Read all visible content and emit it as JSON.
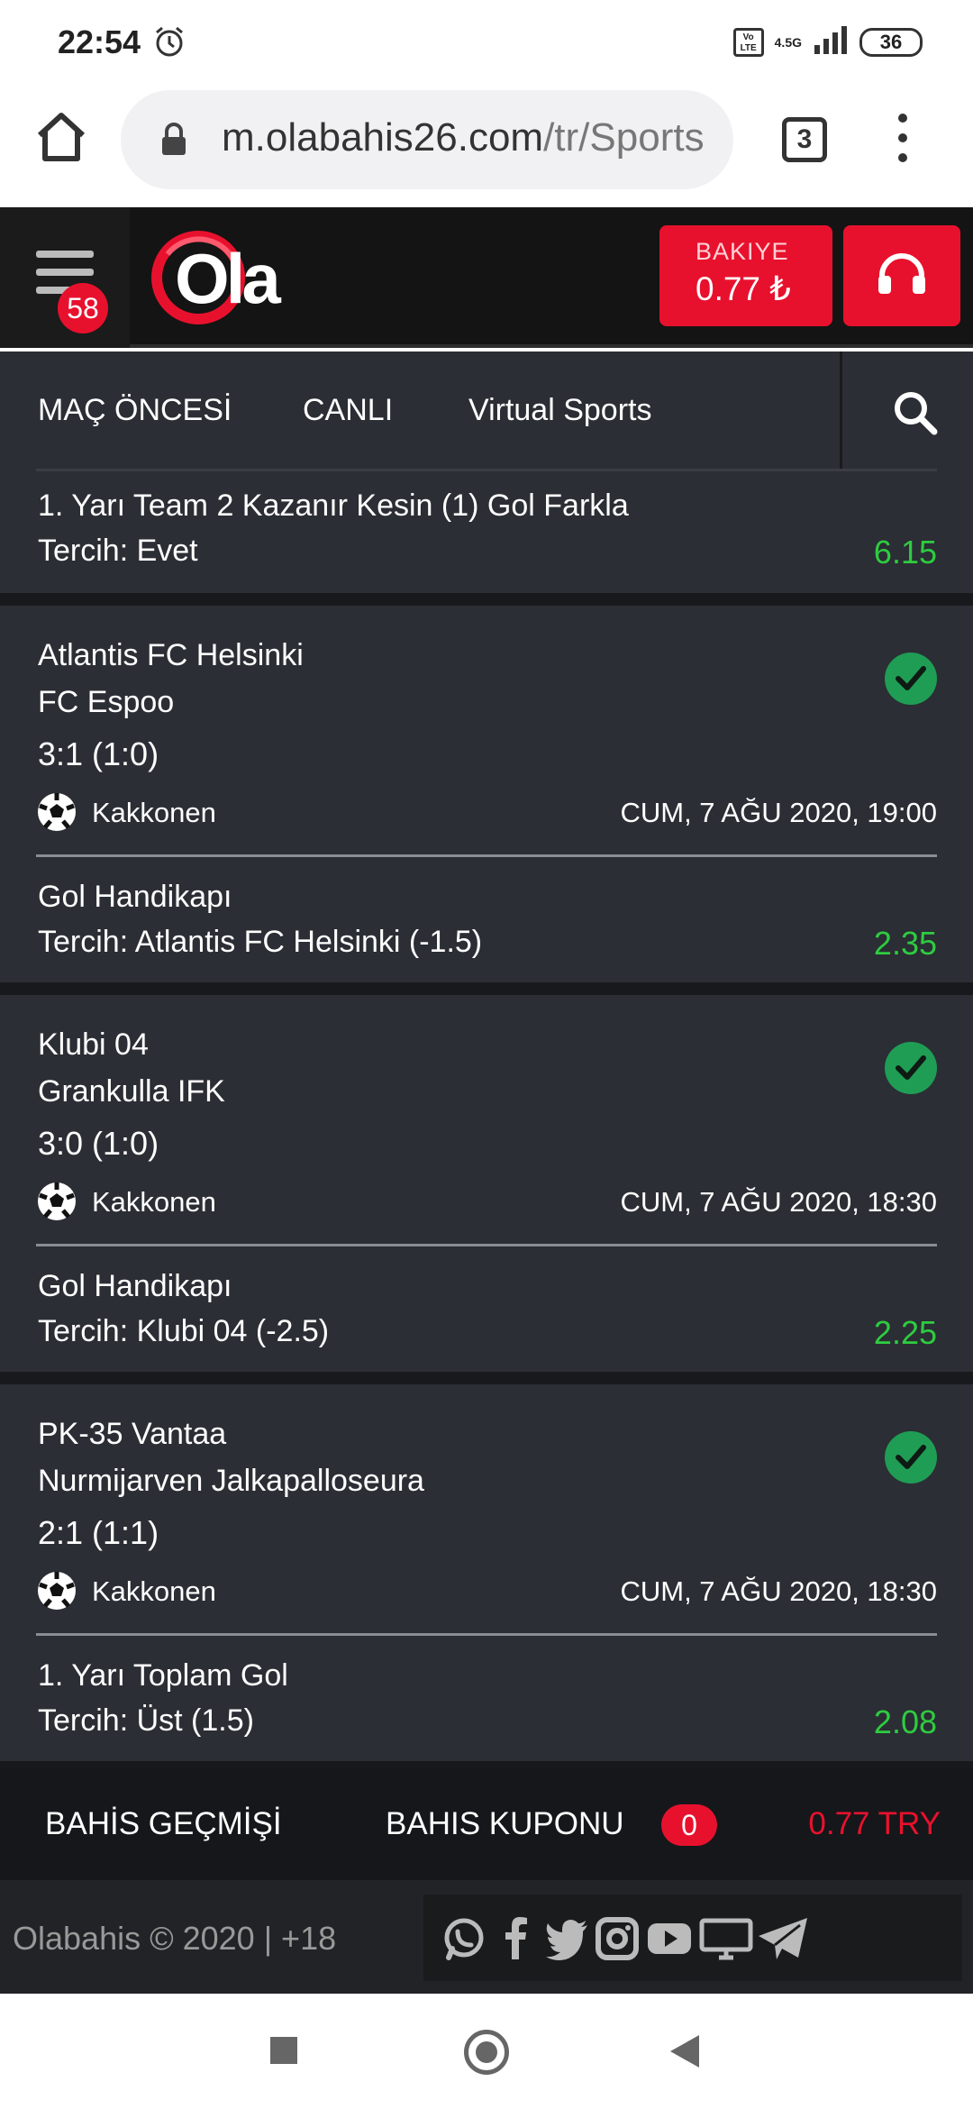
{
  "status_bar": {
    "time": "22:54",
    "network": "4.5G",
    "volte": "Vo LTE",
    "battery": "36"
  },
  "browser": {
    "url_main": "m.olabahis26.com",
    "url_rest": "/tr/Sports",
    "tab_count": "3"
  },
  "header": {
    "logo_text": "Ola",
    "menu_badge": "58",
    "balance_label": "BAKIYE",
    "balance_value": "0.77 ₺"
  },
  "nav": {
    "items": [
      "MAÇ ÖNCESİ",
      "CANLI",
      "Virtual Sports"
    ]
  },
  "bets": {
    "partial": {
      "market": "1. Yarı Team 2 Kazanır Kesin (1) Gol Farkla",
      "selection": "Tercih: Evet",
      "odds": "6.15"
    },
    "items": [
      {
        "team1": "Atlantis FC Helsinki",
        "team2": "FC Espoo",
        "score": "3:1 (1:0)",
        "league": "Kakkonen",
        "datetime": "CUM, 7 AĞU 2020, 19:00",
        "market": "Gol Handikapı",
        "selection": "Tercih: Atlantis FC Helsinki (-1.5)",
        "odds": "2.35"
      },
      {
        "team1": "Klubi 04",
        "team2": "Grankulla IFK",
        "score": "3:0 (1:0)",
        "league": "Kakkonen",
        "datetime": "CUM, 7 AĞU 2020, 18:30",
        "market": "Gol Handikapı",
        "selection": "Tercih: Klubi 04 (-2.5)",
        "odds": "2.25"
      },
      {
        "team1": "PK-35 Vantaa",
        "team2": "Nurmijarven Jalkapalloseura",
        "score": "2:1 (1:1)",
        "league": "Kakkonen",
        "datetime": "CUM, 7 AĞU 2020, 18:30",
        "market": "1. Yarı Toplam Gol",
        "selection": "Tercih: Üst (1.5)",
        "odds": "2.08"
      }
    ]
  },
  "bottom_bar": {
    "history": "BAHİS GEÇMİŞİ",
    "coupon": "BAHIS KUPONU",
    "coupon_count": "0",
    "amount": "0.77 TRY"
  },
  "footer": {
    "copyright": "Olabahis © 2020 | +18",
    "social_icons": [
      "whatsapp-icon",
      "facebook-icon",
      "twitter-icon",
      "instagram-icon",
      "youtube-icon",
      "tv-icon",
      "telegram-icon"
    ]
  },
  "colors": {
    "brand_red": "#e8112d",
    "odds_green": "#2ecc40",
    "win_green": "#1f9d55",
    "panel": "#2b2e34"
  }
}
